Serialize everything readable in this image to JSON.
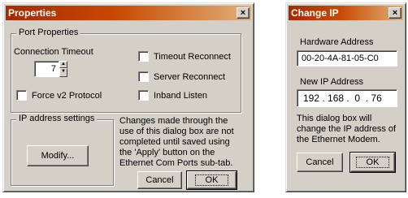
{
  "properties": {
    "title": "Properties",
    "close_symbol": "×",
    "port_group_label": "Port Properties",
    "connection_timeout_label": "Connection Timeout",
    "connection_timeout_value": "7",
    "timeout_reconnect_label": "Timeout Reconnect",
    "server_reconnect_label": "Server Reconnect",
    "force_v2_label": "Force v2 Protocol",
    "inband_listen_label": "Inband Listen",
    "ip_group_label": "IP address settings",
    "modify_label": "Modify...",
    "note_lines": [
      "Changes made through the",
      "use of this dialog box are not",
      "completed until saved using",
      "the 'Apply' button on the",
      "Ethernet Com Ports sub-tab."
    ],
    "cancel_label": "Cancel",
    "ok_label": "OK"
  },
  "change_ip": {
    "title": "Change IP",
    "close_symbol": "×",
    "hardware_label": "Hardware Address",
    "hardware_value": "00-20-4A-81-05-C0",
    "new_ip_label": "New IP Address",
    "new_ip_value": "192 . 168 .  0  . 76",
    "note_lines": [
      "This dialog box will",
      "change the IP address of",
      "the Ethernet Modem."
    ],
    "cancel_label": "Cancel",
    "ok_label": "OK"
  }
}
